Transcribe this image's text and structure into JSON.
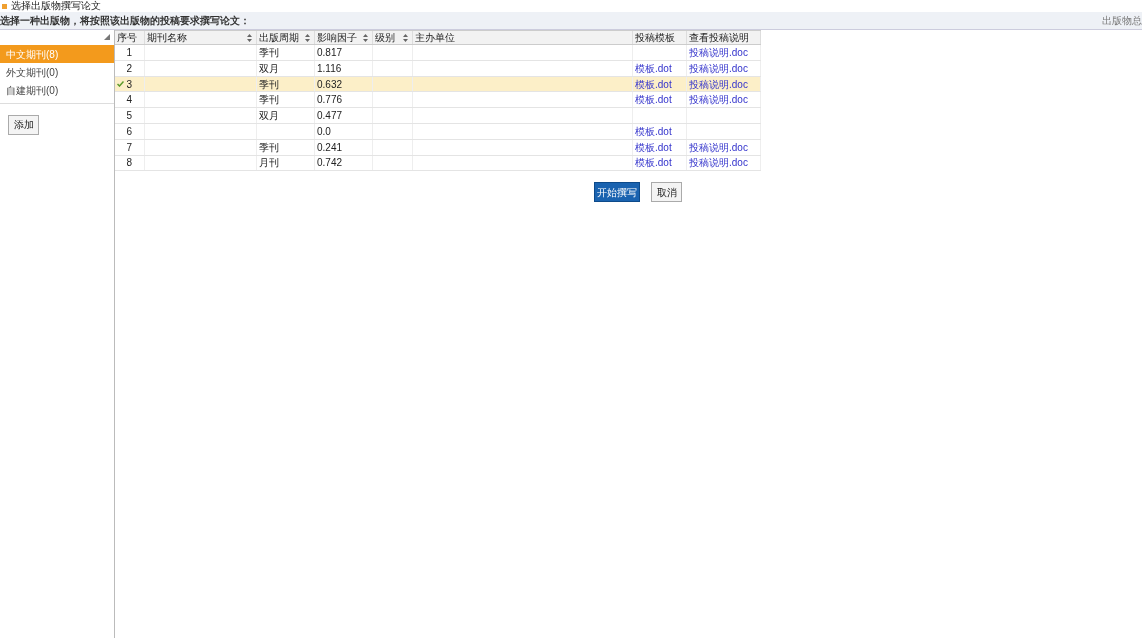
{
  "window": {
    "title": "选择出版物撰写论文"
  },
  "instruction": "选择一种出版物，将按照该出版物的投稿要求撰写论文：",
  "top_right": "出版物总",
  "sidebar": {
    "items": [
      {
        "label": "中文期刊(8)",
        "selected": true
      },
      {
        "label": "外文期刊(0)",
        "selected": false
      },
      {
        "label": "自建期刊(0)",
        "selected": false
      }
    ],
    "add_button": "添加"
  },
  "table": {
    "columns": [
      {
        "label": "序号",
        "sortable": false
      },
      {
        "label": "期刊名称",
        "sortable": true
      },
      {
        "label": "出版周期",
        "sortable": true
      },
      {
        "label": "影响因子",
        "sortable": true
      },
      {
        "label": "级别",
        "sortable": true
      },
      {
        "label": "主办单位",
        "sortable": false
      },
      {
        "label": "投稿模板",
        "sortable": false
      },
      {
        "label": "查看投稿说明",
        "sortable": false
      }
    ],
    "rows": [
      {
        "index": "1",
        "selected": false,
        "period": "季刊",
        "factor": "0.817",
        "template": "",
        "guide": "投稿说明.doc"
      },
      {
        "index": "2",
        "selected": false,
        "period": "双月",
        "factor": "1.116",
        "template": "模板.dot",
        "guide": "投稿说明.doc"
      },
      {
        "index": "3",
        "selected": true,
        "period": "季刊",
        "factor": "0.632",
        "template": "模板.dot",
        "guide": "投稿说明.doc"
      },
      {
        "index": "4",
        "selected": false,
        "period": "季刊",
        "factor": "0.776",
        "template": "模板.dot",
        "guide": "投稿说明.doc"
      },
      {
        "index": "5",
        "selected": false,
        "period": "双月",
        "factor": "0.477",
        "template": "",
        "guide": ""
      },
      {
        "index": "6",
        "selected": false,
        "period": "",
        "factor": "0.0",
        "template": "模板.dot",
        "guide": ""
      },
      {
        "index": "7",
        "selected": false,
        "period": "季刊",
        "factor": "0.241",
        "template": "模板.dot",
        "guide": "投稿说明.doc"
      },
      {
        "index": "8",
        "selected": false,
        "period": "月刊",
        "factor": "0.742",
        "template": "模板.dot",
        "guide": "投稿说明.doc"
      }
    ]
  },
  "buttons": [
    {
      "label": "开始撰写",
      "kind": "primary"
    },
    {
      "label": "取消",
      "kind": "secondary"
    }
  ]
}
